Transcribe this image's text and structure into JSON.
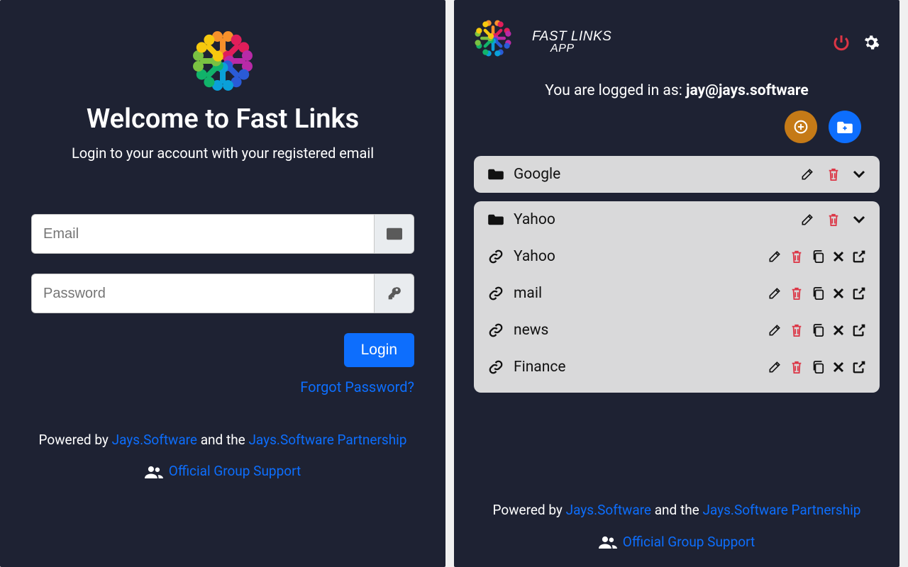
{
  "brand": {
    "line1": "FAST LINKS",
    "line2": "APP"
  },
  "login": {
    "title": "Welcome to Fast Links",
    "subtitle": "Login to your account with your registered email",
    "email_placeholder": "Email",
    "password_placeholder": "Password",
    "login_button": "Login",
    "forgot_password": "Forgot Password?"
  },
  "dashboard": {
    "logged_in_prefix": "You are logged in as: ",
    "logged_in_user": "jay@jays.software",
    "folders": [
      {
        "name": "Google",
        "expanded": false,
        "links": []
      },
      {
        "name": "Yahoo",
        "expanded": true,
        "links": [
          {
            "name": "Yahoo"
          },
          {
            "name": "mail"
          },
          {
            "name": "news"
          },
          {
            "name": "Finance"
          }
        ]
      }
    ]
  },
  "footer": {
    "powered_prefix": "Powered by ",
    "link1": "Jays.Software",
    "middle": " and the ",
    "link2": "Jays.Software Partnership",
    "support": "Official Group Support"
  },
  "logo_colors": [
    "#f7912b",
    "#e01e5a",
    "#b82aa7",
    "#2a5bd7",
    "#0aa0d9",
    "#11b36a",
    "#7ac142",
    "#f6c90e"
  ]
}
